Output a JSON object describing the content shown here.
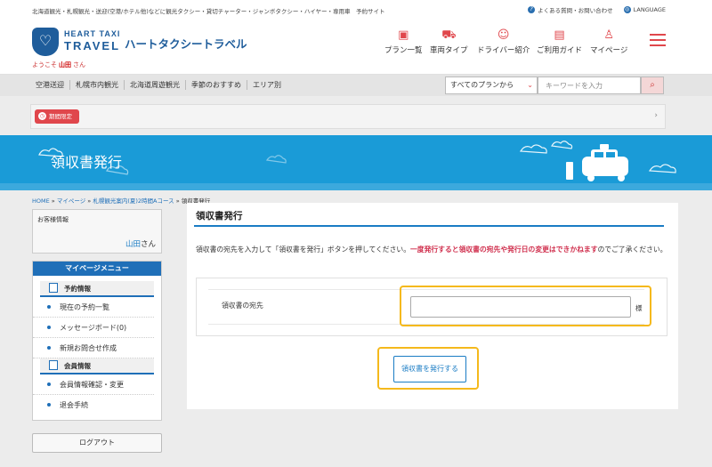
{
  "topbar": {
    "tagline": "北海道観光・札幌観光・送迎(空港/ホテル他)などに観光タクシー・貸切チャーター・ジャンボタクシー・ハイヤー・専用車　予約サイト",
    "faq": "よくある質問・お問い合わせ",
    "language": "LANGUAGE"
  },
  "header": {
    "logo_en_top": "HEART TAXI",
    "logo_en_bottom": "TRAVEL",
    "logo_jp": "ハートタクシートラベル",
    "welcome_prefix": "ようこそ",
    "user_name": "山田",
    "welcome_suffix": "さん",
    "nav": [
      {
        "label": "プラン一覧",
        "icon": "suitcase-icon"
      },
      {
        "label": "車両タイプ",
        "icon": "car-icon"
      },
      {
        "label": "ドライバー紹介",
        "icon": "driver-icon"
      },
      {
        "label": "ご利用ガイド",
        "icon": "book-icon"
      },
      {
        "label": "マイページ",
        "icon": "person-icon"
      }
    ]
  },
  "subnav": {
    "links": [
      "空港送迎",
      "札幌市内観光",
      "北海道周遊観光",
      "季節のおすすめ",
      "エリア別"
    ],
    "plan_select": "すべてのプランから",
    "search_placeholder": "キーワードを入力"
  },
  "notice": {
    "tag": "期間限定"
  },
  "banner": {
    "title": "領収書発行"
  },
  "breadcrumb": [
    "HOME",
    "マイページ",
    "札幌観光案内(夏)2時間Aコース",
    "領収書発行"
  ],
  "sidebar": {
    "customer_title": "お客様情報",
    "customer_name": "山田",
    "customer_suffix": "さん",
    "menu_title": "マイページメニュー",
    "section_booking": "予約情報",
    "booking_items": [
      "現在の予約一覧",
      "メッセージボード(0)",
      "新規お問合せ作成"
    ],
    "section_member": "会員情報",
    "member_items": [
      "会員情報確認・変更",
      "退会手続"
    ],
    "logout": "ログアウト"
  },
  "main": {
    "title": "領収書発行",
    "desc_before": "領収書の宛先を入力して「領収書を発行」ボタンを押してください。",
    "desc_warning": "一度発行すると領収書の宛先や発行日の変更はできかねます",
    "desc_after": "のでご了承ください。",
    "field_label": "領収書の宛先",
    "field_value": "",
    "field_suffix": "様",
    "submit": "領収書を発行する"
  },
  "colors": {
    "brand_blue": "#1f5d9b",
    "banner_blue": "#1a9bd7",
    "accent_red": "#e0474c",
    "highlight": "#f5b91c"
  }
}
